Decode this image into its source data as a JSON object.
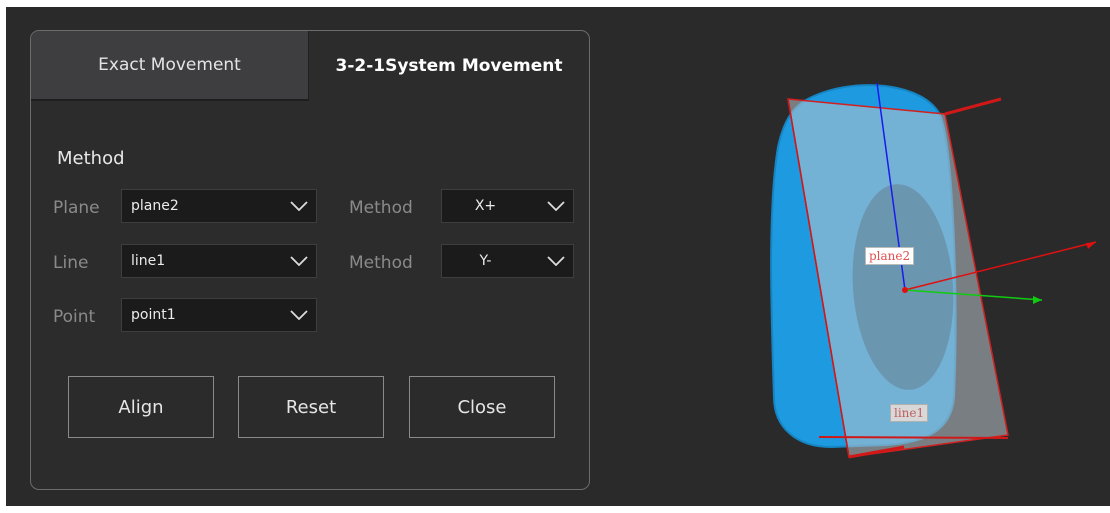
{
  "panel": {
    "tabs": [
      {
        "label": "Exact Movement",
        "active": false
      },
      {
        "label": "3-2-1System  Movement",
        "active": true
      }
    ],
    "section_title": "Method",
    "rows": [
      {
        "label": "Plane",
        "value": "plane2",
        "method_label": "Method",
        "method_value": "X+"
      },
      {
        "label": "Line",
        "value": "line1",
        "method_label": "Method",
        "method_value": "Y-"
      },
      {
        "label": "Point",
        "value": "point1"
      }
    ],
    "buttons": {
      "align": "Align",
      "reset": "Reset",
      "close": "Close"
    }
  },
  "viewport": {
    "labels": {
      "plane": "plane2",
      "line": "line1"
    },
    "colors": {
      "model": "#1e9be0",
      "model_inner": "#0d5f8e",
      "plane_fill": "#9aa6b0",
      "plane_edge": "#d02020",
      "axis_z": "#1a1aee",
      "axis_x": "#e01010",
      "axis_y": "#10cc10"
    }
  }
}
